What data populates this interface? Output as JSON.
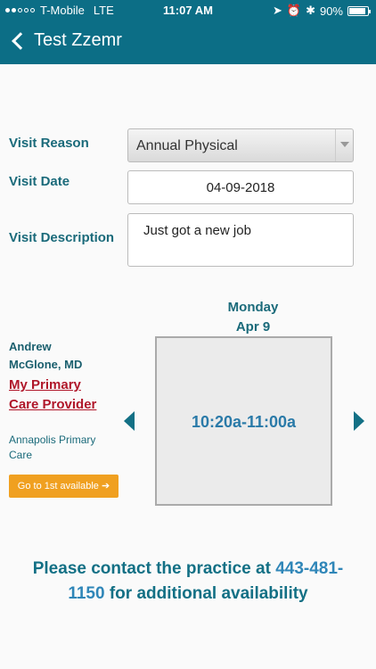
{
  "status_bar": {
    "carrier": "T-Mobile",
    "network": "LTE",
    "time": "11:07 AM",
    "battery": "90%",
    "battery_level": 0.9
  },
  "nav": {
    "back_label": "Test Zzemr"
  },
  "form": {
    "visit_reason_label": "Visit Reason",
    "visit_reason_value": "Annual Physical",
    "visit_date_label": "Visit Date",
    "visit_date_value": "04-09-2018",
    "visit_description_label": "Visit Description",
    "visit_description_value": "Just got a new job"
  },
  "schedule": {
    "day": "Monday",
    "date": "Apr 9",
    "slot": "10:20a-11:00a"
  },
  "provider": {
    "name_line1": "Andrew",
    "name_line2": "McGlone, MD",
    "link_line1": "My Primary",
    "link_line2": "Care Provider",
    "practice_line1": "Annapolis Primary",
    "practice_line2": "Care",
    "goto_label": "Go to 1st available ➔"
  },
  "contact": {
    "prefix": "Please contact the practice at",
    "phone_part1": "443-481-",
    "phone_part2": "1150",
    "suffix": "for additional availability"
  },
  "colors": {
    "header": "#0c6e86",
    "accent": "#137085",
    "link": "#b0172a",
    "button": "#f0a020"
  }
}
